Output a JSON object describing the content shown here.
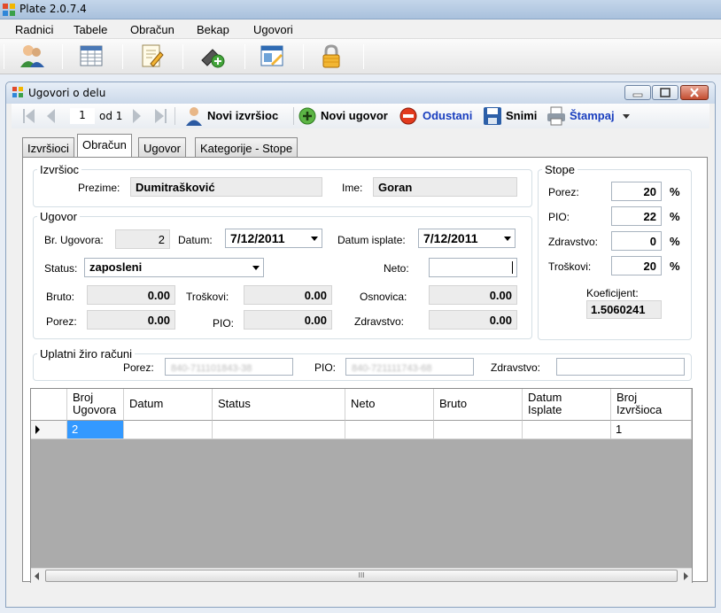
{
  "app": {
    "title": "Plate 2.0.7.4"
  },
  "menu": [
    "Radnici",
    "Tabele",
    "Obračun",
    "Bekap",
    "Ugovori"
  ],
  "toolbar_icons": [
    "workers-icon",
    "table-icon",
    "edit-document-icon",
    "add-device-icon",
    "calendar-window-icon",
    "lock-icon"
  ],
  "child_window": {
    "title": "Ugovori o delu"
  },
  "navigator": {
    "position": "1",
    "count_label": "od 1",
    "new_performer": "Novi izvršioc",
    "new_contract": "Novi ugovor",
    "cancel": "Odustani",
    "save": "Snimi",
    "print": "Štampaj"
  },
  "tabs": [
    "Izvršioci",
    "Obračun",
    "Ugovor",
    "Kategorije - Stope"
  ],
  "izvrsioc": {
    "legend": "Izvršioc",
    "prezime_label": "Prezime:",
    "prezime": "Dumitrašković",
    "ime_label": "Ime:",
    "ime": "Goran"
  },
  "ugovor": {
    "legend": "Ugovor",
    "br_label": "Br. Ugovora:",
    "br": "2",
    "datum_label": "Datum:",
    "datum": "7/12/2011",
    "datum_isplate_label": "Datum isplate:",
    "datum_isplate": "7/12/2011",
    "status_label": "Status:",
    "status": "zaposleni",
    "neto_label": "Neto:",
    "neto": "",
    "bruto_label": "Bruto:",
    "bruto": "0.00",
    "troskovi_label": "Troškovi:",
    "troskovi": "0.00",
    "osnovica_label": "Osnovica:",
    "osnovica": "0.00",
    "porez_label": "Porez:",
    "porez": "0.00",
    "pio_label": "PIO:",
    "pio": "0.00",
    "zdravstvo_label": "Zdravstvo:",
    "zdravstvo": "0.00"
  },
  "stope": {
    "legend": "Stope",
    "porez_label": "Porez:",
    "porez": "20",
    "pio_label": "PIO:",
    "pio": "22",
    "zdravstvo_label": "Zdravstvo:",
    "zdravstvo": "0",
    "troskovi_label": "Troškovi:",
    "troskovi": "20",
    "pct": "%",
    "koef_label": "Koeficijent:",
    "koef": "1.5060241"
  },
  "ziro": {
    "legend": "Uplatni žiro računi",
    "porez_label": "Porez:",
    "porez": "840-711101843-38",
    "pio_label": "PIO:",
    "pio": "840-721111743-68",
    "zdravstvo_label": "Zdravstvo:",
    "zdravstvo": ""
  },
  "grid": {
    "headers": [
      [
        "Broj",
        "Ugovora"
      ],
      [
        "Datum",
        ""
      ],
      [
        "Status",
        ""
      ],
      [
        "Neto",
        ""
      ],
      [
        "Bruto",
        ""
      ],
      [
        "Datum",
        "Isplate"
      ],
      [
        "Broj",
        "Izvršioca"
      ]
    ],
    "rows": [
      [
        "2",
        "",
        "",
        "",
        "",
        "",
        "1"
      ]
    ],
    "scroll_glyph": "III"
  }
}
